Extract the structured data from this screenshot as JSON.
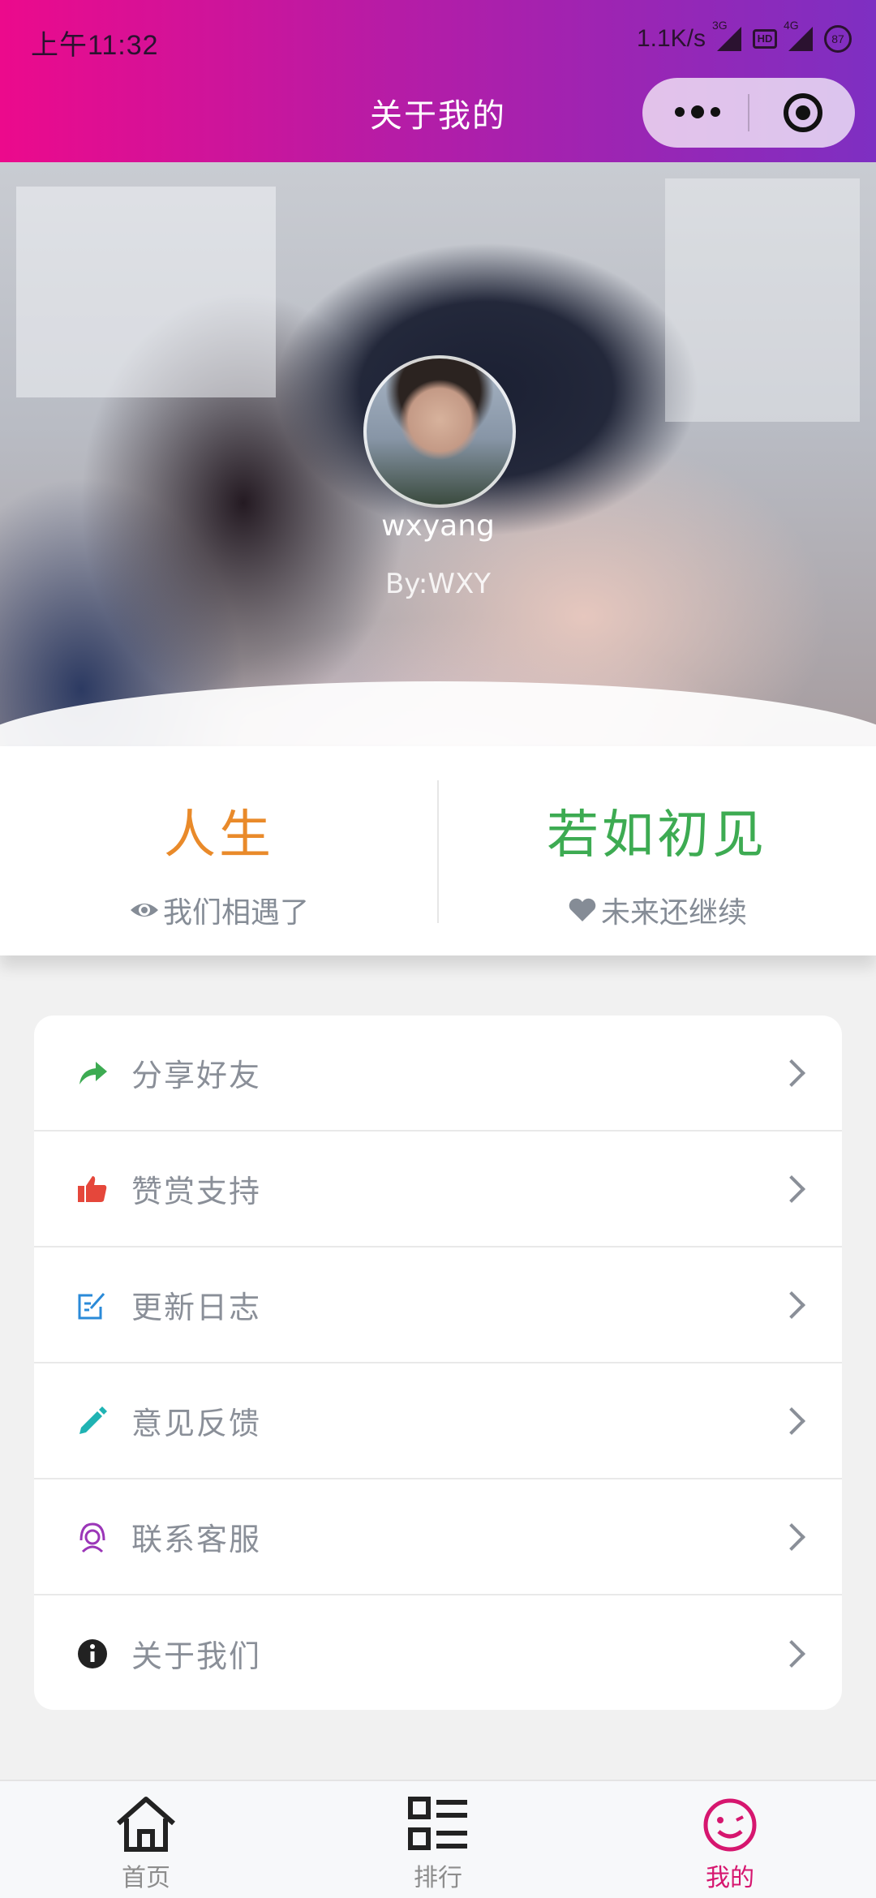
{
  "status_bar": {
    "time": "上午11:32",
    "network_speed": "1.1K/s",
    "sig1_tag": "3G",
    "hd_label": "HD",
    "sig2_tag": "4G",
    "battery": "87"
  },
  "header": {
    "title": "关于我的",
    "capsule_icons": [
      "more-dots-icon",
      "close-target-icon"
    ]
  },
  "profile": {
    "name": "wxyang",
    "subtitle": "By:WXY"
  },
  "stats": [
    {
      "title": "人生",
      "caption": "我们相遇了",
      "icon": "eye-icon",
      "color": "#e98a2a"
    },
    {
      "title": "若如初见",
      "caption": "未来还继续",
      "icon": "heart-icon",
      "color": "#3dab52"
    }
  ],
  "menu": {
    "items": [
      {
        "label": "分享好友",
        "icon": "share-arrow-icon",
        "color": "#3dab52"
      },
      {
        "label": "赞赏支持",
        "icon": "thumbs-up-icon",
        "color": "#e5473b"
      },
      {
        "label": "更新日志",
        "icon": "edit-log-icon",
        "color": "#2a8ad8"
      },
      {
        "label": "意见反馈",
        "icon": "pencil-icon",
        "color": "#1fb3b3"
      },
      {
        "label": "联系客服",
        "icon": "headset-icon",
        "color": "#9b36b8"
      },
      {
        "label": "关于我们",
        "icon": "info-icon",
        "color": "#222222"
      }
    ]
  },
  "tabbar": {
    "tabs": [
      {
        "label": "首页",
        "icon": "home-icon",
        "active": false
      },
      {
        "label": "排行",
        "icon": "list-icon",
        "active": false
      },
      {
        "label": "我的",
        "icon": "smiley-icon",
        "active": true
      }
    ],
    "active_color": "#d6166f"
  }
}
